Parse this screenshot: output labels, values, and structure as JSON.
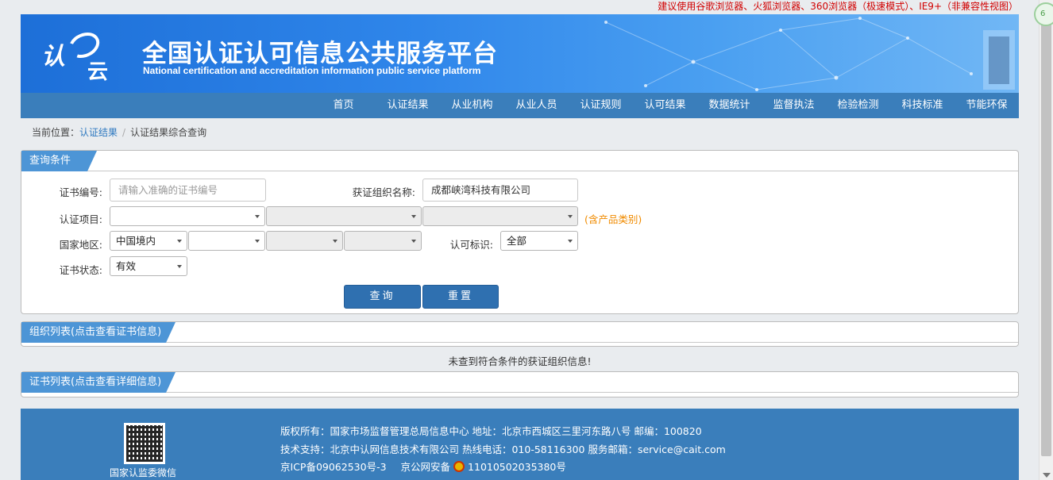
{
  "browser_notice": "建议使用谷歌浏览器、火狐浏览器、360浏览器（极速模式）、IE9+（非兼容性视图）",
  "header": {
    "logo_text_1": "认",
    "logo_text_2": "云",
    "title": "全国认证认可信息公共服务平台",
    "subtitle": "National certification and accreditation information public service platform"
  },
  "nav": [
    "首页",
    "认证结果",
    "从业机构",
    "从业人员",
    "认证规则",
    "认可结果",
    "数据统计",
    "监督执法",
    "检验检测",
    "科技标准",
    "节能环保"
  ],
  "breadcrumb": {
    "prefix": "当前位置：",
    "link": "认证结果",
    "current": "认证结果综合查询"
  },
  "query": {
    "panel_title": "查询条件",
    "cert_no_label": "证书编号:",
    "cert_no_placeholder": "请输入准确的证书编号",
    "org_name_label": "获证组织名称:",
    "org_name_value": "成都峡湾科技有限公司",
    "project_label": "认证项目:",
    "project_hint": "(含产品类别)",
    "region_label": "国家地区:",
    "region_value": "中国境内",
    "accred_label": "认可标识:",
    "accred_value": "全部",
    "status_label": "证书状态:",
    "status_value": "有效",
    "search_button": "查询",
    "reset_button": "重置"
  },
  "org_list": {
    "title": "组织列表(点击查看证书信息)",
    "empty_message": "未查到符合条件的获证组织信息!"
  },
  "cert_list": {
    "title": "证书列表(点击查看详细信息)"
  },
  "footer": {
    "qr_caption": "国家认监委微信",
    "line1": "版权所有：国家市场监督管理总局信息中心    地址：北京市西城区三里河东路八号    邮编：100820",
    "line2": "技术支持：北京中认网信息技术有限公司    热线电话：010-58116300    服务邮箱：service@cait.com",
    "icp": "京ICP备09062530号-3",
    "police_prefix": "京公网安备",
    "police_no": "11010502035380号"
  },
  "colors": {
    "header_blue": "#2f86ea",
    "nav_blue": "#3a7ebb",
    "tab_blue": "#4d95d6",
    "button_blue": "#2f70b0",
    "hint_orange": "#f08b00",
    "notice_red": "#d10000"
  }
}
